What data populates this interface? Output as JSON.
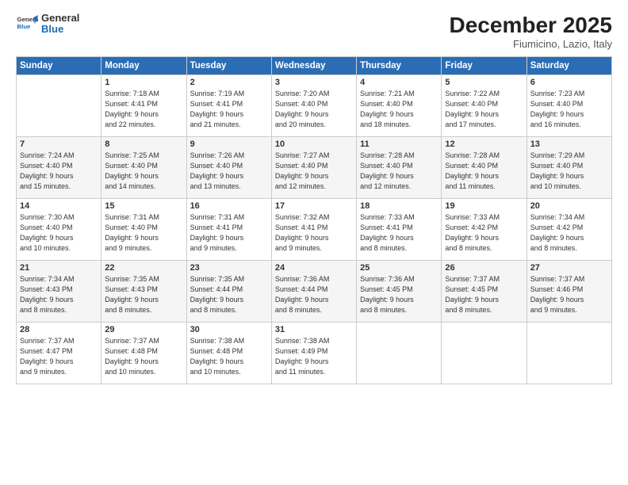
{
  "header": {
    "logo_line1": "General",
    "logo_line2": "Blue",
    "month_title": "December 2025",
    "location": "Fiumicino, Lazio, Italy"
  },
  "days_of_week": [
    "Sunday",
    "Monday",
    "Tuesday",
    "Wednesday",
    "Thursday",
    "Friday",
    "Saturday"
  ],
  "weeks": [
    [
      {
        "day": "",
        "content": ""
      },
      {
        "day": "1",
        "content": "Sunrise: 7:18 AM\nSunset: 4:41 PM\nDaylight: 9 hours\nand 22 minutes."
      },
      {
        "day": "2",
        "content": "Sunrise: 7:19 AM\nSunset: 4:41 PM\nDaylight: 9 hours\nand 21 minutes."
      },
      {
        "day": "3",
        "content": "Sunrise: 7:20 AM\nSunset: 4:40 PM\nDaylight: 9 hours\nand 20 minutes."
      },
      {
        "day": "4",
        "content": "Sunrise: 7:21 AM\nSunset: 4:40 PM\nDaylight: 9 hours\nand 18 minutes."
      },
      {
        "day": "5",
        "content": "Sunrise: 7:22 AM\nSunset: 4:40 PM\nDaylight: 9 hours\nand 17 minutes."
      },
      {
        "day": "6",
        "content": "Sunrise: 7:23 AM\nSunset: 4:40 PM\nDaylight: 9 hours\nand 16 minutes."
      }
    ],
    [
      {
        "day": "7",
        "content": "Sunrise: 7:24 AM\nSunset: 4:40 PM\nDaylight: 9 hours\nand 15 minutes."
      },
      {
        "day": "8",
        "content": "Sunrise: 7:25 AM\nSunset: 4:40 PM\nDaylight: 9 hours\nand 14 minutes."
      },
      {
        "day": "9",
        "content": "Sunrise: 7:26 AM\nSunset: 4:40 PM\nDaylight: 9 hours\nand 13 minutes."
      },
      {
        "day": "10",
        "content": "Sunrise: 7:27 AM\nSunset: 4:40 PM\nDaylight: 9 hours\nand 12 minutes."
      },
      {
        "day": "11",
        "content": "Sunrise: 7:28 AM\nSunset: 4:40 PM\nDaylight: 9 hours\nand 12 minutes."
      },
      {
        "day": "12",
        "content": "Sunrise: 7:28 AM\nSunset: 4:40 PM\nDaylight: 9 hours\nand 11 minutes."
      },
      {
        "day": "13",
        "content": "Sunrise: 7:29 AM\nSunset: 4:40 PM\nDaylight: 9 hours\nand 10 minutes."
      }
    ],
    [
      {
        "day": "14",
        "content": "Sunrise: 7:30 AM\nSunset: 4:40 PM\nDaylight: 9 hours\nand 10 minutes."
      },
      {
        "day": "15",
        "content": "Sunrise: 7:31 AM\nSunset: 4:40 PM\nDaylight: 9 hours\nand 9 minutes."
      },
      {
        "day": "16",
        "content": "Sunrise: 7:31 AM\nSunset: 4:41 PM\nDaylight: 9 hours\nand 9 minutes."
      },
      {
        "day": "17",
        "content": "Sunrise: 7:32 AM\nSunset: 4:41 PM\nDaylight: 9 hours\nand 9 minutes."
      },
      {
        "day": "18",
        "content": "Sunrise: 7:33 AM\nSunset: 4:41 PM\nDaylight: 9 hours\nand 8 minutes."
      },
      {
        "day": "19",
        "content": "Sunrise: 7:33 AM\nSunset: 4:42 PM\nDaylight: 9 hours\nand 8 minutes."
      },
      {
        "day": "20",
        "content": "Sunrise: 7:34 AM\nSunset: 4:42 PM\nDaylight: 9 hours\nand 8 minutes."
      }
    ],
    [
      {
        "day": "21",
        "content": "Sunrise: 7:34 AM\nSunset: 4:43 PM\nDaylight: 9 hours\nand 8 minutes."
      },
      {
        "day": "22",
        "content": "Sunrise: 7:35 AM\nSunset: 4:43 PM\nDaylight: 9 hours\nand 8 minutes."
      },
      {
        "day": "23",
        "content": "Sunrise: 7:35 AM\nSunset: 4:44 PM\nDaylight: 9 hours\nand 8 minutes."
      },
      {
        "day": "24",
        "content": "Sunrise: 7:36 AM\nSunset: 4:44 PM\nDaylight: 9 hours\nand 8 minutes."
      },
      {
        "day": "25",
        "content": "Sunrise: 7:36 AM\nSunset: 4:45 PM\nDaylight: 9 hours\nand 8 minutes."
      },
      {
        "day": "26",
        "content": "Sunrise: 7:37 AM\nSunset: 4:45 PM\nDaylight: 9 hours\nand 8 minutes."
      },
      {
        "day": "27",
        "content": "Sunrise: 7:37 AM\nSunset: 4:46 PM\nDaylight: 9 hours\nand 9 minutes."
      }
    ],
    [
      {
        "day": "28",
        "content": "Sunrise: 7:37 AM\nSunset: 4:47 PM\nDaylight: 9 hours\nand 9 minutes."
      },
      {
        "day": "29",
        "content": "Sunrise: 7:37 AM\nSunset: 4:48 PM\nDaylight: 9 hours\nand 10 minutes."
      },
      {
        "day": "30",
        "content": "Sunrise: 7:38 AM\nSunset: 4:48 PM\nDaylight: 9 hours\nand 10 minutes."
      },
      {
        "day": "31",
        "content": "Sunrise: 7:38 AM\nSunset: 4:49 PM\nDaylight: 9 hours\nand 11 minutes."
      },
      {
        "day": "",
        "content": ""
      },
      {
        "day": "",
        "content": ""
      },
      {
        "day": "",
        "content": ""
      }
    ]
  ]
}
